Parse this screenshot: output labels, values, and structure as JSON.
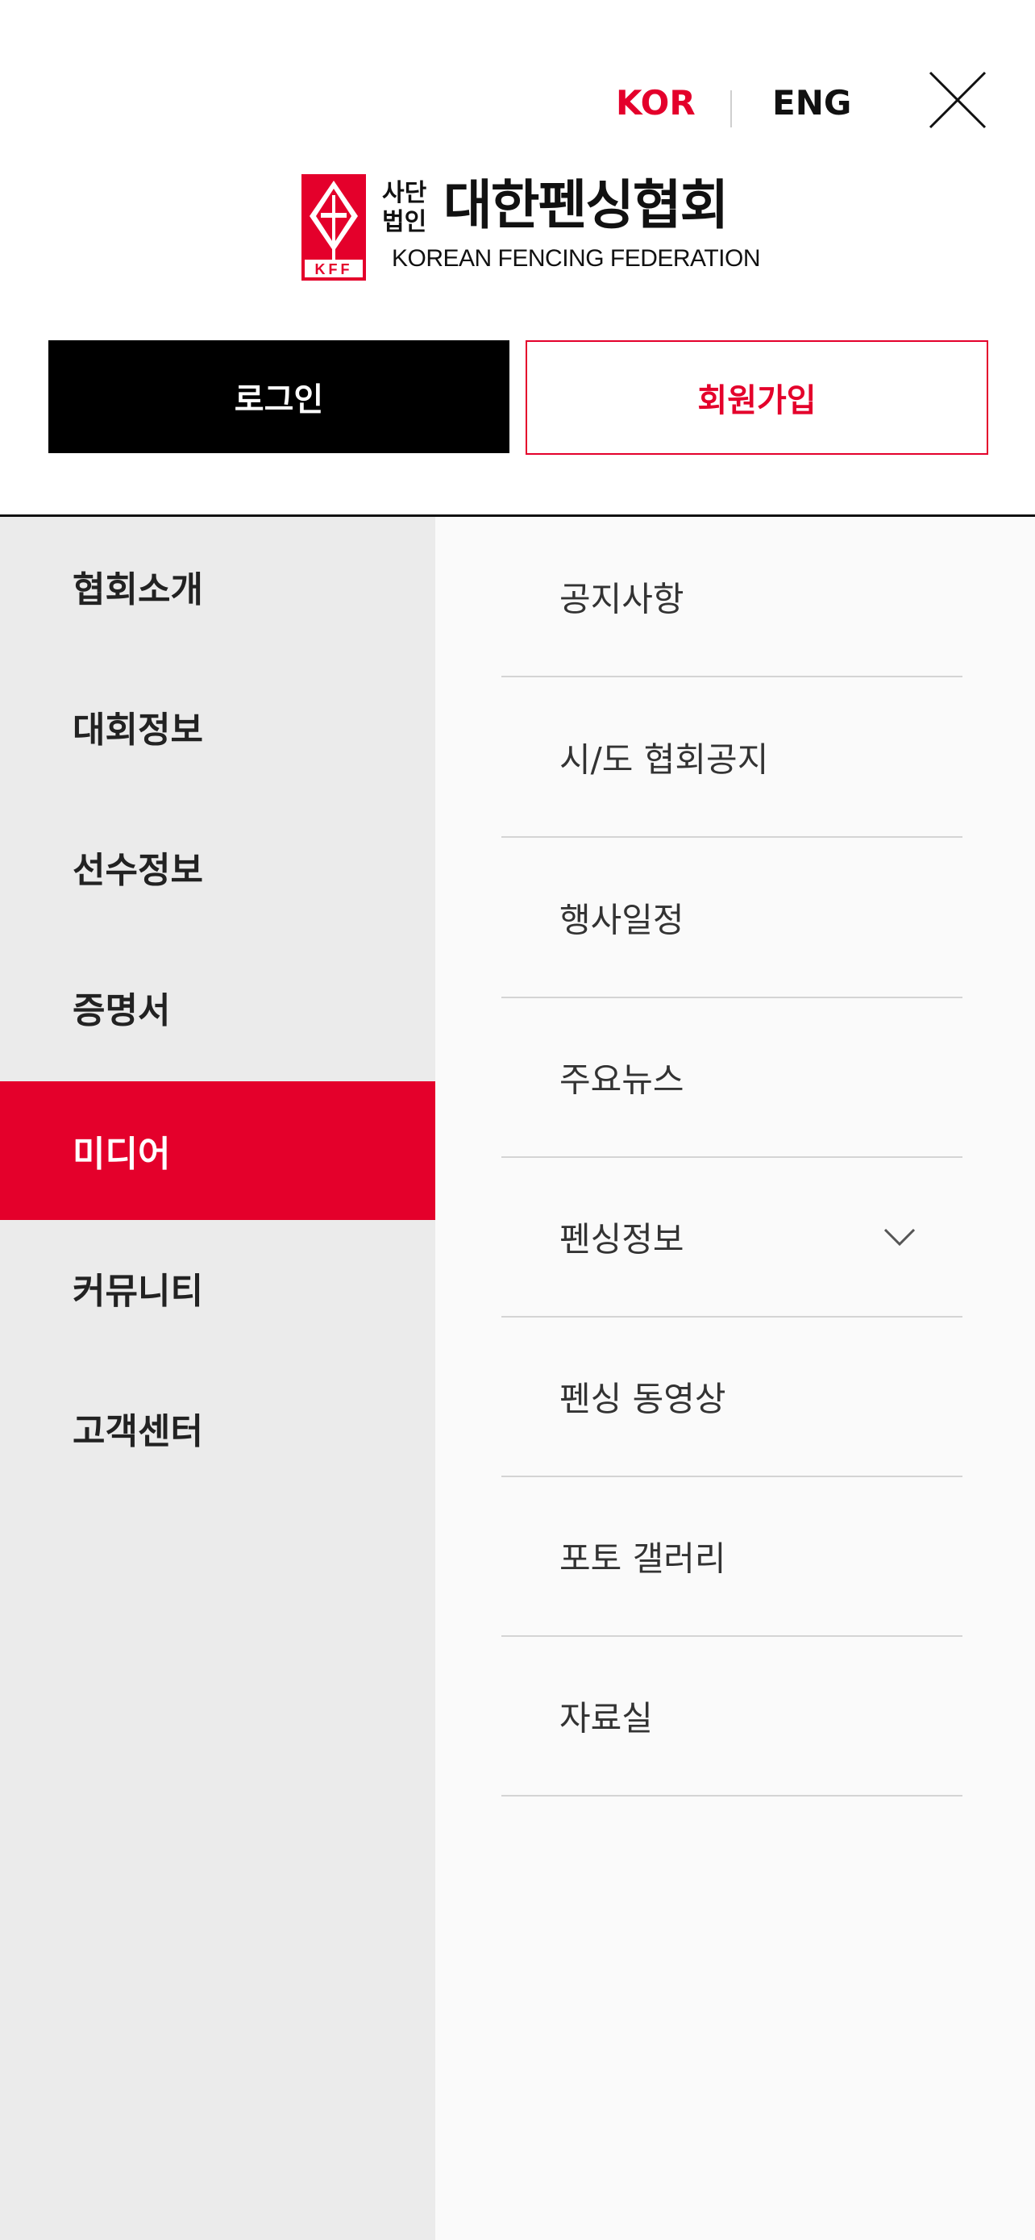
{
  "header": {
    "lang_kor": "KOR",
    "lang_eng": "ENG",
    "logo": {
      "mark_text": "KFF",
      "prefix": "사단 법인",
      "name": "대한펜싱협회",
      "english": "KOREAN FENCING FEDERATION"
    },
    "login_label": "로그인",
    "join_label": "회원가입"
  },
  "left_menu": [
    {
      "label": "협회소개"
    },
    {
      "label": "대회정보"
    },
    {
      "label": "선수정보"
    },
    {
      "label": "증명서"
    },
    {
      "label": "미디어",
      "active": true
    },
    {
      "label": "커뮤니티"
    },
    {
      "label": "고객센터"
    }
  ],
  "submenu": [
    {
      "label": "공지사항"
    },
    {
      "label": "시/도 협회공지"
    },
    {
      "label": "행사일정"
    },
    {
      "label": "주요뉴스"
    },
    {
      "label": "펜싱정보",
      "icon": "chevron-down-icon"
    },
    {
      "label": "펜싱 동영상"
    },
    {
      "label": "포토 갤러리"
    },
    {
      "label": "자료실"
    }
  ],
  "colors": {
    "accent": "#e4002b",
    "black": "#000000",
    "left_bg": "#ebebeb",
    "right_bg": "#fafafa"
  }
}
